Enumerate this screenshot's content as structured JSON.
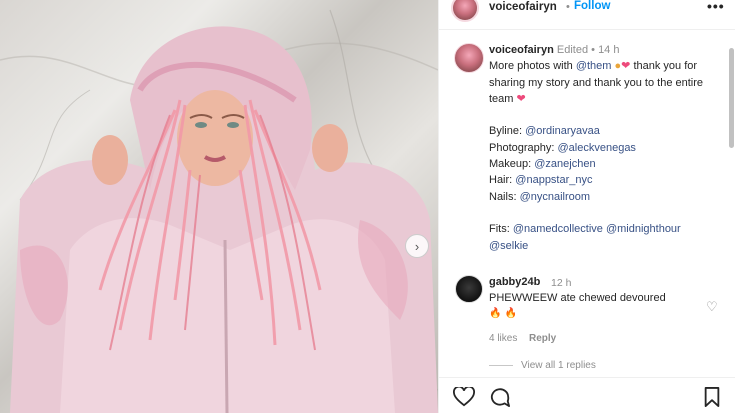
{
  "post": {
    "username": "voiceofairyn",
    "dot": "•",
    "follow_label": "Follow",
    "more_icon": "more-icon"
  },
  "caption": {
    "username": "voiceofairyn",
    "edited": "Edited",
    "dot": "•",
    "time": "14 h",
    "line1_a": "More photos with",
    "mention_them": "@them",
    "line1_b": "thank you for sharing my story and thank you to the entire team",
    "byline_label": "Byline:",
    "byline": "@ordinaryavaa",
    "photography_label": "Photography:",
    "photography": "@aleckvenegas",
    "makeup_label": "Makeup:",
    "makeup": "@zanejchen",
    "hair_label": "Hair:",
    "hair": "@nappstar_nyc",
    "nails_label": "Nails:",
    "nails": "@nycnailroom",
    "fits_label": "Fits:",
    "fits_1": "@namedcollective",
    "fits_2": "@midnighthour",
    "fits_3": "@selkie"
  },
  "comment": {
    "username": "gabby24b",
    "time": "12 h",
    "text": "PHEWWEEW ate chewed devoured",
    "emoji": "🔥🔥",
    "likes": "4 likes",
    "reply": "Reply",
    "view_replies": "View all 1 replies"
  },
  "colors": {
    "link": "#385185",
    "follow": "#0095f6",
    "muted": "#8e8e8e",
    "heart": "#ed4a7b"
  },
  "icons": [
    "heart-icon",
    "comment-icon",
    "bookmark-icon",
    "chevron-right-icon",
    "more-icon"
  ]
}
